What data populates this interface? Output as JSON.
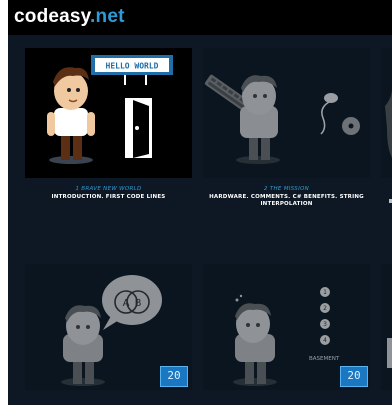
{
  "site": {
    "name": "codeasy",
    "tld": ".net"
  },
  "chapters": [
    {
      "number": "1 BRAVE NEW WORLD",
      "description": "INTRODUCTION. FIRST CODE LINES",
      "sign": "HELLO WORLD"
    },
    {
      "number": "2 THE MISSION",
      "description": "HARDWARE. COMMENTS. C# BENEFITS. STRING INTERPOLATION"
    }
  ],
  "locked_tiles": [
    {
      "bubble": "A B",
      "badge": "20"
    },
    {
      "steps": [
        "1",
        "2",
        "3",
        "4"
      ],
      "sign": "BASEMENT",
      "badge": "20"
    }
  ],
  "colors": {
    "accent": "#2f9ad8",
    "background": "#0e1824"
  }
}
